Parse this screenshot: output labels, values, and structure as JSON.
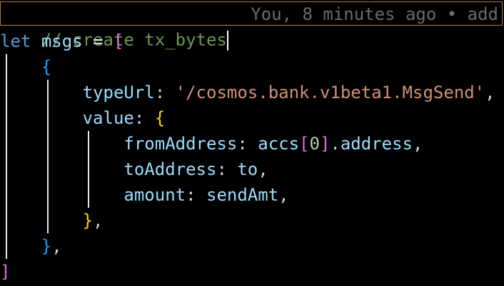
{
  "editor": {
    "lines": [
      {
        "tokens": [
          {
            "text": "// create tx_bytes",
            "type": "comment"
          }
        ]
      },
      {
        "tokens": [
          {
            "text": "let",
            "type": "keyword"
          },
          {
            "text": " ",
            "type": "punct"
          },
          {
            "text": "msgs",
            "type": "var"
          },
          {
            "text": " = ",
            "type": "punct"
          },
          {
            "text": "[",
            "type": "brk1"
          }
        ]
      },
      {
        "tokens": [
          {
            "text": "    ",
            "type": "punct"
          },
          {
            "text": "{",
            "type": "brk2"
          }
        ]
      },
      {
        "tokens": [
          {
            "text": "        ",
            "type": "punct"
          },
          {
            "text": "typeUrl",
            "type": "var"
          },
          {
            "text": ": ",
            "type": "punct"
          },
          {
            "text": "'/cosmos.bank.v1beta1.MsgSend'",
            "type": "string"
          },
          {
            "text": ",",
            "type": "punct"
          }
        ]
      },
      {
        "tokens": [
          {
            "text": "        ",
            "type": "punct"
          },
          {
            "text": "value",
            "type": "var"
          },
          {
            "text": ": ",
            "type": "punct"
          },
          {
            "text": "{",
            "type": "brk3"
          }
        ]
      },
      {
        "tokens": [
          {
            "text": "            ",
            "type": "punct"
          },
          {
            "text": "fromAddress",
            "type": "var"
          },
          {
            "text": ": ",
            "type": "punct"
          },
          {
            "text": "accs",
            "type": "var"
          },
          {
            "text": "[",
            "type": "brk1"
          },
          {
            "text": "0",
            "type": "number"
          },
          {
            "text": "]",
            "type": "brk1"
          },
          {
            "text": ".",
            "type": "punct"
          },
          {
            "text": "address",
            "type": "var"
          },
          {
            "text": ",",
            "type": "punct"
          }
        ]
      },
      {
        "tokens": [
          {
            "text": "            ",
            "type": "punct"
          },
          {
            "text": "toAddress",
            "type": "var"
          },
          {
            "text": ": ",
            "type": "punct"
          },
          {
            "text": "to",
            "type": "var"
          },
          {
            "text": ",",
            "type": "punct"
          }
        ]
      },
      {
        "tokens": [
          {
            "text": "            ",
            "type": "punct"
          },
          {
            "text": "amount",
            "type": "var"
          },
          {
            "text": ": ",
            "type": "punct"
          },
          {
            "text": "sendAmt",
            "type": "var"
          },
          {
            "text": ",",
            "type": "punct"
          }
        ]
      },
      {
        "tokens": [
          {
            "text": "        ",
            "type": "punct"
          },
          {
            "text": "}",
            "type": "brk3"
          },
          {
            "text": ",",
            "type": "punct"
          }
        ]
      },
      {
        "tokens": [
          {
            "text": "    ",
            "type": "punct"
          },
          {
            "text": "}",
            "type": "brk2"
          },
          {
            "text": ",",
            "type": "punct"
          }
        ]
      },
      {
        "tokens": [
          {
            "text": "]",
            "type": "brk1"
          }
        ]
      }
    ],
    "blame": "You, 8 minutes ago • add",
    "current_line": 1
  },
  "colors": {
    "background": "#000000",
    "comment": "#6a9955",
    "keyword": "#569cd6",
    "variable": "#9cdcfe",
    "string": "#ce9178",
    "number": "#b5cea8",
    "bracket_level_1": "#da70d6",
    "bracket_level_2": "#179fff",
    "bracket_level_3": "#ffd700",
    "blame_text": "#6b6b6b",
    "current_line_border": "#b07a3a"
  }
}
